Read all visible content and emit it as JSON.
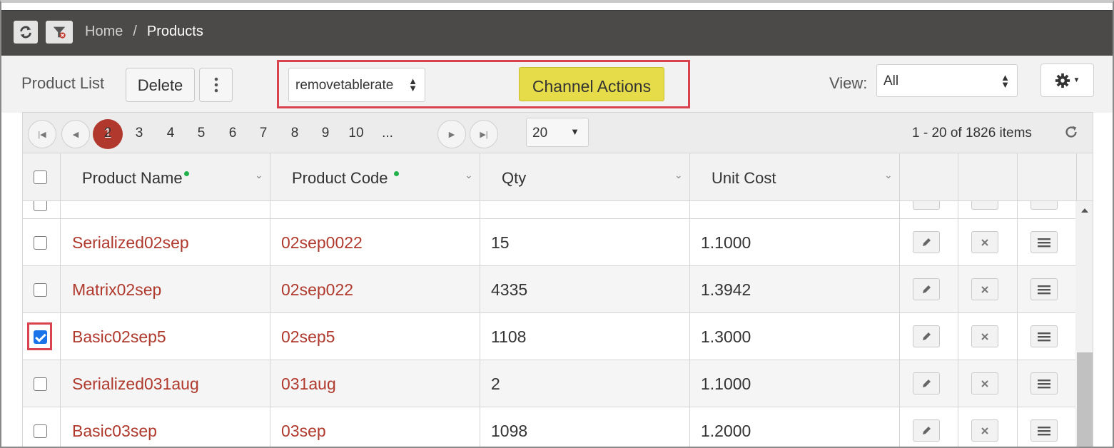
{
  "breadcrumb": {
    "home": "Home",
    "separator": "/",
    "current": "Products"
  },
  "topbar_icons": [
    "refresh-icon",
    "filter-clear-icon"
  ],
  "toolbar": {
    "title": "Product List",
    "delete_label": "Delete",
    "channel_select_value": "removetablerate",
    "channel_actions_label": "Channel Actions",
    "view_label": "View:",
    "view_value": "All"
  },
  "pager": {
    "current": "1",
    "pages": [
      "2",
      "3",
      "4",
      "5",
      "6",
      "7",
      "8",
      "9",
      "10",
      "..."
    ],
    "page_size": "20",
    "info": "1 - 20 of 1826 items"
  },
  "columns": {
    "name": "Product Name",
    "code": "Product Code",
    "qty": "Qty",
    "cost": "Unit Cost"
  },
  "rows": [
    {
      "name": "Serialized02sep",
      "code": "02sep0022",
      "qty": "15",
      "cost": "1.1000",
      "checked": false
    },
    {
      "name": "Matrix02sep",
      "code": "02sep022",
      "qty": "4335",
      "cost": "1.3942",
      "checked": false
    },
    {
      "name": "Basic02sep5",
      "code": "02sep5",
      "qty": "1108",
      "cost": "1.3000",
      "checked": true
    },
    {
      "name": "Serialized031aug",
      "code": "031aug",
      "qty": "2",
      "cost": "1.1000",
      "checked": false
    },
    {
      "name": "Basic03sep",
      "code": "03sep",
      "qty": "1098",
      "cost": "1.2000",
      "checked": false
    }
  ],
  "colors": {
    "link": "#b0392d",
    "accent_page": "#b0382d",
    "channel_button": "#e6dc4a",
    "highlight": "#d9434d",
    "checkbox_checked": "#1a73e8",
    "sorted_dot": "#22b14c"
  }
}
